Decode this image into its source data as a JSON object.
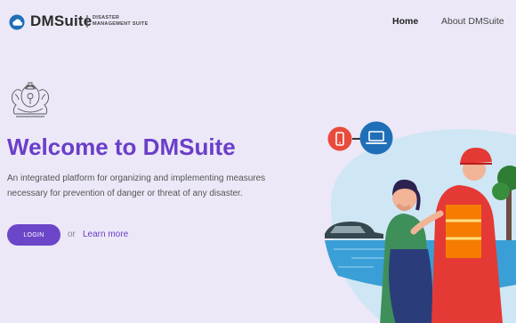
{
  "header": {
    "brand_name": "DMSuite",
    "brand_separator": "|",
    "brand_tagline_line1": "DISASTER",
    "brand_tagline_line2": "MANAGEMENT SUITE",
    "nav": {
      "home": "Home",
      "about": "About DMSuite"
    }
  },
  "hero": {
    "title": "Welcome to DMSuite",
    "description": "An integrated platform for organizing and implementing measures necessary for prevention of danger or threat of any disaster.",
    "login_label": "LOGIN",
    "or_text": "or",
    "learn_more_label": "Learn more"
  },
  "colors": {
    "background": "#ece8f7",
    "accent": "#6a3ec9",
    "button": "#6c46c8",
    "phone_icon": "#e94a3b",
    "laptop_icon": "#1f6fb8"
  },
  "icons": {
    "logo": "cloud-shield-icon",
    "emblem": "state-emblem-icon",
    "phone": "mobile-phone-icon",
    "laptop": "laptop-icon"
  }
}
